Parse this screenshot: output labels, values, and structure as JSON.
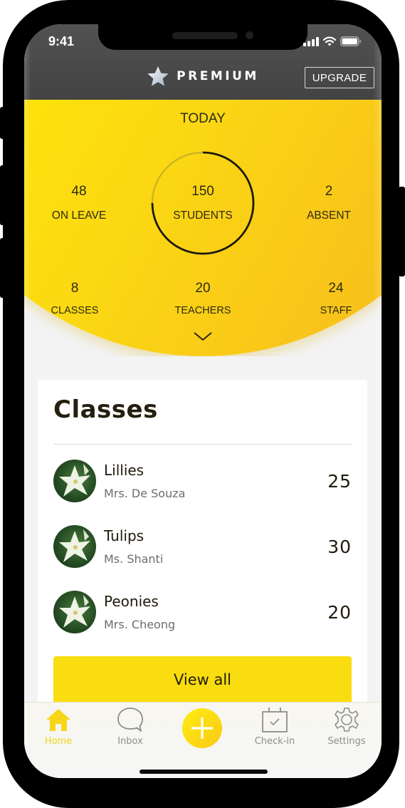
{
  "status_bar": {
    "time": "9:41",
    "icons": [
      "signal-icon",
      "wifi-icon",
      "battery-icon"
    ]
  },
  "header": {
    "badge_icon": "star-icon",
    "title": "PREMIUM",
    "upgrade_label": "UPGRADE"
  },
  "stats": {
    "period_label": "TODAY",
    "on_leave": {
      "value": "48",
      "label": "ON LEAVE"
    },
    "students": {
      "value": "150",
      "label": "STUDENTS",
      "ring_progress": 0.75
    },
    "absent": {
      "value": "2",
      "label": "ABSENT"
    },
    "classes": {
      "value": "8",
      "label": "CLASSES"
    },
    "teachers": {
      "value": "20",
      "label": "TEACHERS"
    },
    "staff": {
      "value": "24",
      "label": "STAFF"
    },
    "expand_icon": "chevron-down-icon"
  },
  "classes_card": {
    "title": "Classes",
    "items": [
      {
        "name": "Lillies",
        "teacher": "Mrs. De Souza",
        "count": "25",
        "avatar": "white-lily-photo"
      },
      {
        "name": "Tulips",
        "teacher": "Ms. Shanti",
        "count": "30",
        "avatar": "white-lily-photo"
      },
      {
        "name": "Peonies",
        "teacher": "Mrs. Cheong",
        "count": "20",
        "avatar": "white-lily-photo"
      }
    ],
    "view_all_label": "View all"
  },
  "tab_bar": {
    "tabs": [
      {
        "label": "Home",
        "icon": "home-icon",
        "active": true
      },
      {
        "label": "Inbox",
        "icon": "chat-bubble-icon",
        "active": false
      },
      {
        "label": "",
        "icon": "plus-icon",
        "active": false
      },
      {
        "label": "Check-in",
        "icon": "calendar-check-icon",
        "active": false
      },
      {
        "label": "Settings",
        "icon": "gear-icon",
        "active": false
      }
    ]
  },
  "colors": {
    "accent_yellow": "#fadd10",
    "active_tab": "#f6d619",
    "header_dark": "#4a4a4a",
    "inactive_tab": "#8d8d8d"
  }
}
